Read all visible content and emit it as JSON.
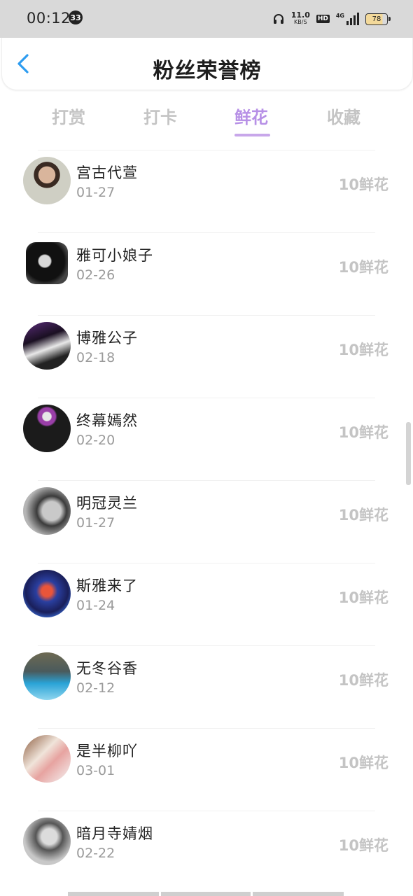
{
  "status_bar": {
    "time": "00:12",
    "notification_count": "33",
    "net_speed": "11.0",
    "net_unit": "KB/S",
    "hd": "HD",
    "network": "4G",
    "battery": "78"
  },
  "header": {
    "title": "粉丝荣誉榜"
  },
  "tabs": [
    {
      "label": "打赏",
      "active": false
    },
    {
      "label": "打卡",
      "active": false
    },
    {
      "label": "鲜花",
      "active": true
    },
    {
      "label": "收藏",
      "active": false
    }
  ],
  "fans": [
    {
      "name": "宫古代萱",
      "date": "01-27",
      "amount": "10鲜花"
    },
    {
      "name": "雅可小娘子",
      "date": "02-26",
      "amount": "10鲜花"
    },
    {
      "name": "博雅公子",
      "date": "02-18",
      "amount": "10鲜花"
    },
    {
      "name": "终幕嫣然",
      "date": "02-20",
      "amount": "10鲜花"
    },
    {
      "name": "明冠灵兰",
      "date": "01-27",
      "amount": "10鲜花"
    },
    {
      "name": "斯雅来了",
      "date": "01-24",
      "amount": "10鲜花"
    },
    {
      "name": "无冬谷香",
      "date": "02-12",
      "amount": "10鲜花"
    },
    {
      "name": "是半柳吖",
      "date": "03-01",
      "amount": "10鲜花"
    },
    {
      "name": "暗月寺婧烟",
      "date": "02-22",
      "amount": "10鲜花"
    }
  ],
  "colors": {
    "accent": "#b790e6",
    "back_arrow": "#2d9cf0",
    "inactive_tab": "#c4c4c4"
  }
}
